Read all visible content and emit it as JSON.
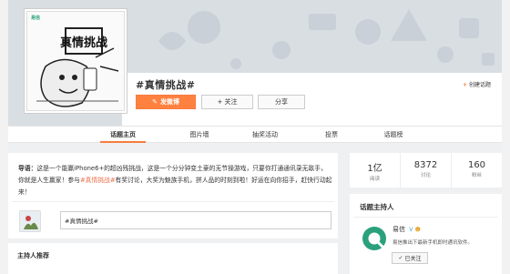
{
  "banner": {
    "logo_text": "易信",
    "avatar_art_text": "真情挑战"
  },
  "topic": {
    "title": "#真情挑战#",
    "post_label": "发微博",
    "follow_label": "+ 关注",
    "share_label": "分享",
    "create_label": "创建话题"
  },
  "tabs": [
    {
      "label": "话题主页",
      "active": true
    },
    {
      "label": "图片墙",
      "active": false
    },
    {
      "label": "抽奖活动",
      "active": false
    },
    {
      "label": "投票",
      "active": false
    },
    {
      "label": "话题榜",
      "active": false
    }
  ],
  "intro": {
    "prefix": "导语：",
    "text_1": "这是一个能赢iPhone6+的超凶残挑战，这是一个分分钟变土豪的无节操游戏，只要你打通通讯录无敌手，你就是人生赢家！参与",
    "hashtag": "#真情挑战#",
    "text_2": "有奖讨论，大奖为魅族手机，拼人品的时刻到啦！好运在向你招手，赶快行动起来！"
  },
  "compose": {
    "value": "#真情挑战#"
  },
  "recommend_title": "主持人推荐",
  "stats": [
    {
      "num": "1亿",
      "label": "阅读"
    },
    {
      "num": "8372",
      "label": "讨论"
    },
    {
      "num": "160",
      "label": "粉丝"
    }
  ],
  "host": {
    "title": "话题主持人",
    "name": "易信",
    "desc": "易信推出下最新手机即时通讯软件。",
    "followed_label": "已关注"
  },
  "colors": {
    "accent": "#ff8140",
    "brand_green": "#2aa07c",
    "hashtag": "#eb7350"
  }
}
